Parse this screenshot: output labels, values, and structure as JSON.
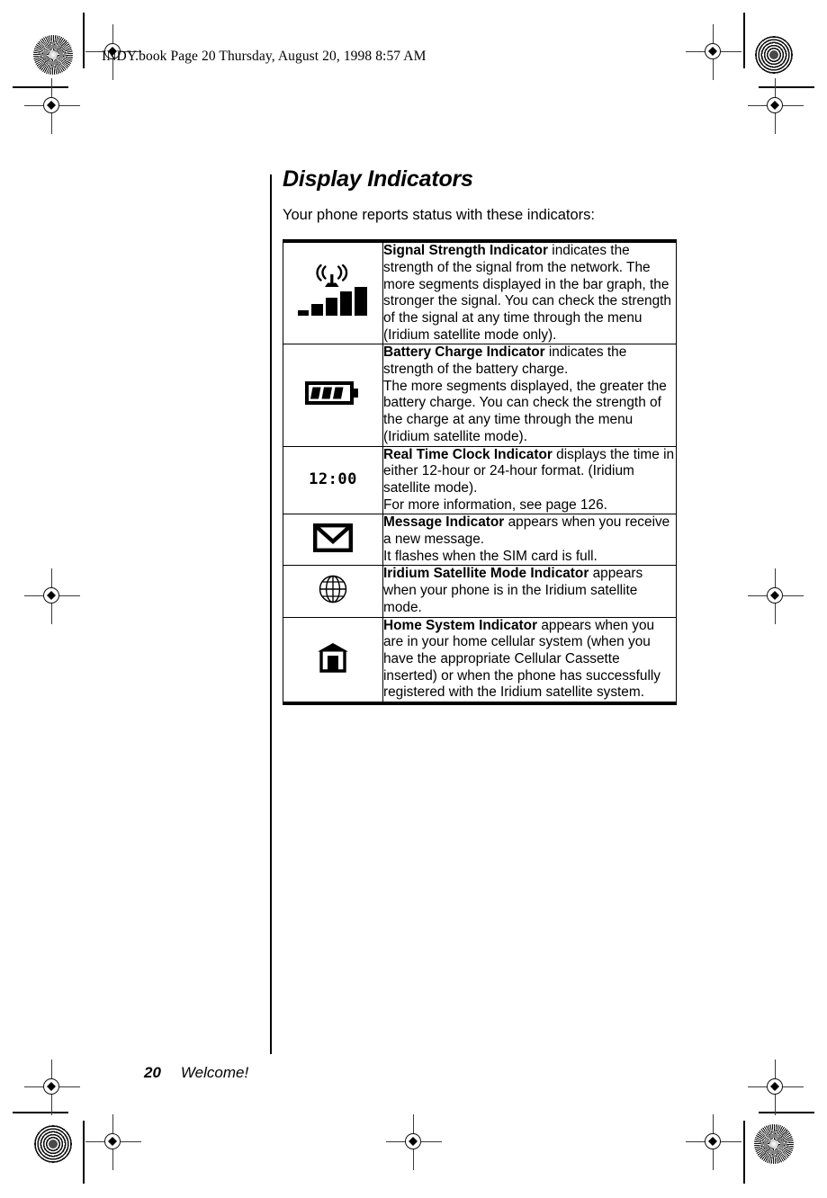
{
  "page_header": "INDY.book  Page 20  Thursday, August 20, 1998  8:57 AM",
  "title": "Display Indicators",
  "intro": "Your phone reports status with these indicators:",
  "footer": {
    "page_number": "20",
    "section": "Welcome!"
  },
  "table": {
    "rows": [
      {
        "icon": "signal-strength-icon",
        "lines": [
          {
            "bold": "Signal Strength Indicator",
            "text": " indicates the strength of the signal from the network. The more segments displayed in the bar graph, the stronger the signal. You can check the strength of the signal at any time through the menu (Iridium satellite mode only)."
          }
        ]
      },
      {
        "icon": "battery-charge-icon",
        "lines": [
          {
            "bold": "Battery Charge Indicator",
            "text": " indicates the strength of the battery charge."
          },
          {
            "bold": "",
            "text": "The more segments displayed, the greater the battery charge. You can check the strength of the charge at any time through the menu (Iridium satellite mode)."
          }
        ]
      },
      {
        "icon": "real-time-clock-icon",
        "icon_text": "12:00",
        "lines": [
          {
            "bold": "Real Time Clock Indicator",
            "text": " displays the time in either 12-hour or 24-hour format. (Iridium satellite mode)."
          },
          {
            "bold": "",
            "text": "For more information, see page 126."
          }
        ]
      },
      {
        "icon": "message-envelope-icon",
        "lines": [
          {
            "bold": "Message Indicator",
            "text": " appears when you receive a new message."
          },
          {
            "bold": "",
            "text": "It flashes when the SIM card is full."
          }
        ]
      },
      {
        "icon": "globe-icon",
        "lines": [
          {
            "bold": "Iridium Satellite Mode Indicator",
            "text": " appears when your phone is in the Iridium satellite mode."
          }
        ]
      },
      {
        "icon": "home-house-icon",
        "lines": [
          {
            "bold": "Home System Indicator",
            "text": " appears when you are in your home cellular system (when you have the appropriate Cellular Cassette inserted) or when the phone has successfully registered with the Iridium satellite system."
          }
        ]
      }
    ]
  },
  "colors": {
    "ink": "#000000",
    "paper": "#ffffff"
  }
}
